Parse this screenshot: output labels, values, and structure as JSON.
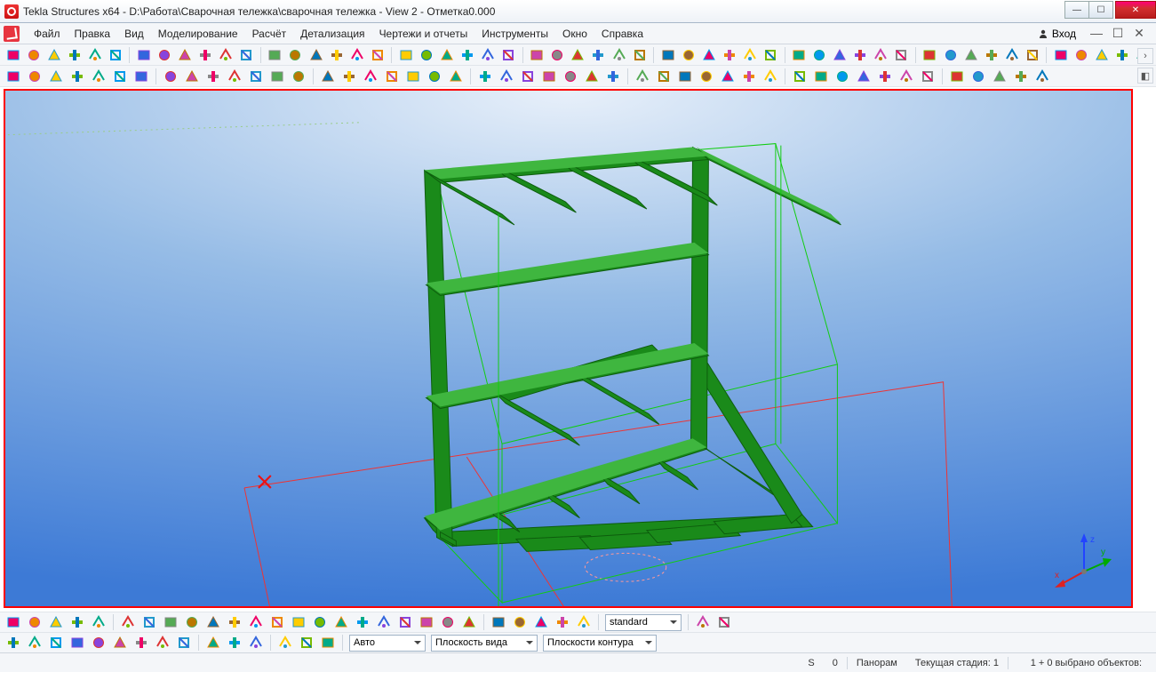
{
  "window": {
    "title": "Tekla Structures x64 - D:\\Работа\\Сварочная тележка\\сварочная тележка  - View 2 - Отметка0.000"
  },
  "menu": {
    "items": [
      "Файл",
      "Правка",
      "Вид",
      "Моделирование",
      "Расчёт",
      "Детализация",
      "Чертежи и отчеты",
      "Инструменты",
      "Окно",
      "Справка"
    ],
    "login": "Вход"
  },
  "toolbar1_icons": [
    "new-file",
    "open-folder",
    "save",
    "share",
    "plus",
    "layers",
    "stack",
    "box3d",
    "undo",
    "redo",
    "undo-arc",
    "redo-arc",
    "select",
    "select-lasso",
    "paint",
    "rect-h",
    "rect-v",
    "copy",
    "cut",
    "scissors",
    "paste",
    "clipboard",
    "dimension",
    "angle",
    "diameter",
    "group",
    "detail",
    "rotate-cw",
    "rotate-ccw",
    "grid-a",
    "grid-b",
    "grid-c",
    "grid-d",
    "grid-e",
    "line-h",
    "line-v",
    "plane",
    "axis",
    "cut-plane",
    "mirror",
    "arrow-ne",
    "snap-a",
    "snap-b",
    "snap-c",
    "snap-d",
    "copy-special",
    "cube-a",
    "cube-b",
    "cube-c",
    "red-flag",
    "truck",
    "user",
    "palette"
  ],
  "toolbar2_icons": [
    "panel-a",
    "panel-b",
    "profile-i",
    "profile-l",
    "profile-u",
    "profile-plate",
    "profile-flat",
    "profile-c",
    "profile-z",
    "profile-t",
    "plate",
    "sheet",
    "weld-a",
    "weld-b",
    "column",
    "beam",
    "brace",
    "arc-beam",
    "vert",
    "anchor",
    "yellow-a",
    "yellow-b",
    "conn-a",
    "conn-b",
    "conn-c",
    "bolt-a",
    "bolt-b",
    "section",
    "bolt-c",
    "bolt-d",
    "bolt-e",
    "point-a",
    "grid-tool",
    "grid-pt",
    "origin",
    "offset",
    "pattern",
    "square",
    "line-tool",
    "freehand",
    "edit-pt",
    "snap-inter",
    "snap-mid",
    "snap-end",
    "snap-perp",
    "circle-a",
    "circle-b"
  ],
  "bottom_row1": {
    "icons_a": [
      "cursor",
      "tree-a",
      "tree-b",
      "group-orange",
      "lock"
    ],
    "icons_b": [
      "wire",
      "hidden",
      "shade-a",
      "shade-b",
      "shade-c",
      "shade-d",
      "shade-e",
      "shade-f",
      "shade-g",
      "shade-h",
      "shade-i",
      "shade-j",
      "shade-k",
      "shade-l",
      "color-a",
      "color-b",
      "edit-a"
    ],
    "icons_c": [
      "sel-a",
      "sel-b",
      "sel-c",
      "sel-d",
      "sel-e"
    ],
    "combo_value": "standard",
    "icons_d": [
      "refresh",
      "apply"
    ]
  },
  "bottom_row2": {
    "icons_a": [
      "cursor",
      "box-a",
      "box-b",
      "box-c",
      "box-d",
      "box-e",
      "box-f",
      "check",
      "eye"
    ],
    "icons_b": [
      "sheet-a",
      "sheet-b",
      "cut-a"
    ],
    "icons_c": [
      "panel-1",
      "panel-2",
      "copy"
    ],
    "combo1": "Авто",
    "combo2": "Плоскость вида",
    "combo3": "Плоскости контура"
  },
  "status": {
    "s": "S",
    "zero": "0",
    "pan": "Панорам",
    "stage": "Текущая стадия: 1",
    "selected": "1 + 0 выбрано объектов:"
  },
  "axes": {
    "x": "x",
    "y": "y",
    "z": "z"
  }
}
